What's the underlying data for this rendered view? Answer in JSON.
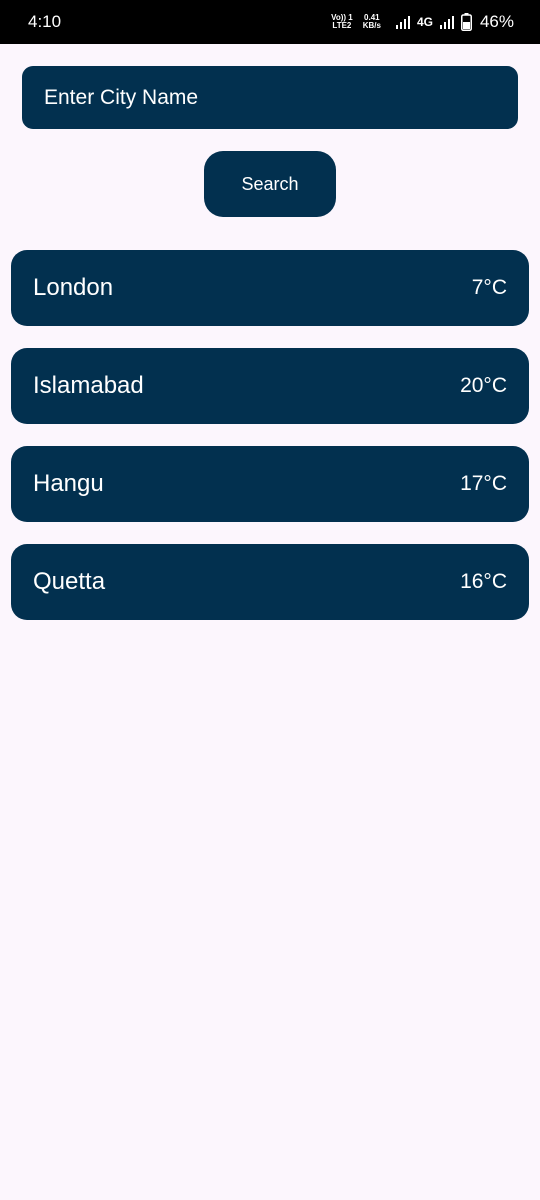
{
  "status_bar": {
    "time": "4:10",
    "volte_top": "Vo)) 1",
    "volte_bottom": "LTE2",
    "speed_value": "0.41",
    "speed_unit": "KB/s",
    "network": "4G",
    "battery": "46%"
  },
  "search": {
    "placeholder": "Enter City Name",
    "button_label": "Search"
  },
  "cities": [
    {
      "name": "London",
      "temp": "7°C"
    },
    {
      "name": "Islamabad",
      "temp": "20°C"
    },
    {
      "name": "Hangu",
      "temp": "17°C"
    },
    {
      "name": "Quetta",
      "temp": "16°C"
    }
  ],
  "colors": {
    "accent": "#02304f",
    "background": "#fcf6fd"
  }
}
